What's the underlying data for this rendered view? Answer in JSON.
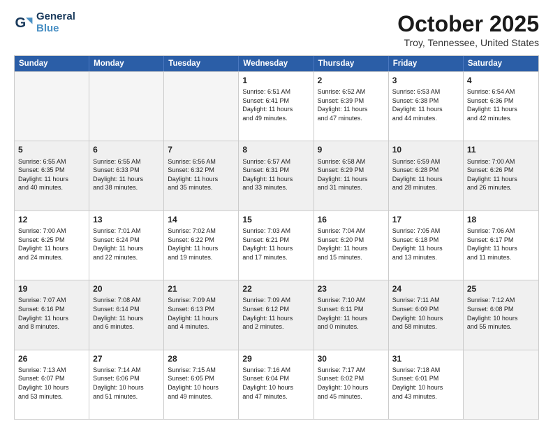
{
  "logo": {
    "line1": "General",
    "line2": "Blue"
  },
  "title": "October 2025",
  "subtitle": "Troy, Tennessee, United States",
  "header_days": [
    "Sunday",
    "Monday",
    "Tuesday",
    "Wednesday",
    "Thursday",
    "Friday",
    "Saturday"
  ],
  "rows": [
    [
      {
        "day": "",
        "text": "",
        "empty": true
      },
      {
        "day": "",
        "text": "",
        "empty": true
      },
      {
        "day": "",
        "text": "",
        "empty": true
      },
      {
        "day": "1",
        "text": "Sunrise: 6:51 AM\nSunset: 6:41 PM\nDaylight: 11 hours\nand 49 minutes."
      },
      {
        "day": "2",
        "text": "Sunrise: 6:52 AM\nSunset: 6:39 PM\nDaylight: 11 hours\nand 47 minutes."
      },
      {
        "day": "3",
        "text": "Sunrise: 6:53 AM\nSunset: 6:38 PM\nDaylight: 11 hours\nand 44 minutes."
      },
      {
        "day": "4",
        "text": "Sunrise: 6:54 AM\nSunset: 6:36 PM\nDaylight: 11 hours\nand 42 minutes."
      }
    ],
    [
      {
        "day": "5",
        "text": "Sunrise: 6:55 AM\nSunset: 6:35 PM\nDaylight: 11 hours\nand 40 minutes.",
        "shaded": true
      },
      {
        "day": "6",
        "text": "Sunrise: 6:55 AM\nSunset: 6:33 PM\nDaylight: 11 hours\nand 38 minutes.",
        "shaded": true
      },
      {
        "day": "7",
        "text": "Sunrise: 6:56 AM\nSunset: 6:32 PM\nDaylight: 11 hours\nand 35 minutes.",
        "shaded": true
      },
      {
        "day": "8",
        "text": "Sunrise: 6:57 AM\nSunset: 6:31 PM\nDaylight: 11 hours\nand 33 minutes.",
        "shaded": true
      },
      {
        "day": "9",
        "text": "Sunrise: 6:58 AM\nSunset: 6:29 PM\nDaylight: 11 hours\nand 31 minutes.",
        "shaded": true
      },
      {
        "day": "10",
        "text": "Sunrise: 6:59 AM\nSunset: 6:28 PM\nDaylight: 11 hours\nand 28 minutes.",
        "shaded": true
      },
      {
        "day": "11",
        "text": "Sunrise: 7:00 AM\nSunset: 6:26 PM\nDaylight: 11 hours\nand 26 minutes.",
        "shaded": true
      }
    ],
    [
      {
        "day": "12",
        "text": "Sunrise: 7:00 AM\nSunset: 6:25 PM\nDaylight: 11 hours\nand 24 minutes."
      },
      {
        "day": "13",
        "text": "Sunrise: 7:01 AM\nSunset: 6:24 PM\nDaylight: 11 hours\nand 22 minutes."
      },
      {
        "day": "14",
        "text": "Sunrise: 7:02 AM\nSunset: 6:22 PM\nDaylight: 11 hours\nand 19 minutes."
      },
      {
        "day": "15",
        "text": "Sunrise: 7:03 AM\nSunset: 6:21 PM\nDaylight: 11 hours\nand 17 minutes."
      },
      {
        "day": "16",
        "text": "Sunrise: 7:04 AM\nSunset: 6:20 PM\nDaylight: 11 hours\nand 15 minutes."
      },
      {
        "day": "17",
        "text": "Sunrise: 7:05 AM\nSunset: 6:18 PM\nDaylight: 11 hours\nand 13 minutes."
      },
      {
        "day": "18",
        "text": "Sunrise: 7:06 AM\nSunset: 6:17 PM\nDaylight: 11 hours\nand 11 minutes."
      }
    ],
    [
      {
        "day": "19",
        "text": "Sunrise: 7:07 AM\nSunset: 6:16 PM\nDaylight: 11 hours\nand 8 minutes.",
        "shaded": true
      },
      {
        "day": "20",
        "text": "Sunrise: 7:08 AM\nSunset: 6:14 PM\nDaylight: 11 hours\nand 6 minutes.",
        "shaded": true
      },
      {
        "day": "21",
        "text": "Sunrise: 7:09 AM\nSunset: 6:13 PM\nDaylight: 11 hours\nand 4 minutes.",
        "shaded": true
      },
      {
        "day": "22",
        "text": "Sunrise: 7:09 AM\nSunset: 6:12 PM\nDaylight: 11 hours\nand 2 minutes.",
        "shaded": true
      },
      {
        "day": "23",
        "text": "Sunrise: 7:10 AM\nSunset: 6:11 PM\nDaylight: 11 hours\nand 0 minutes.",
        "shaded": true
      },
      {
        "day": "24",
        "text": "Sunrise: 7:11 AM\nSunset: 6:09 PM\nDaylight: 10 hours\nand 58 minutes.",
        "shaded": true
      },
      {
        "day": "25",
        "text": "Sunrise: 7:12 AM\nSunset: 6:08 PM\nDaylight: 10 hours\nand 55 minutes.",
        "shaded": true
      }
    ],
    [
      {
        "day": "26",
        "text": "Sunrise: 7:13 AM\nSunset: 6:07 PM\nDaylight: 10 hours\nand 53 minutes."
      },
      {
        "day": "27",
        "text": "Sunrise: 7:14 AM\nSunset: 6:06 PM\nDaylight: 10 hours\nand 51 minutes."
      },
      {
        "day": "28",
        "text": "Sunrise: 7:15 AM\nSunset: 6:05 PM\nDaylight: 10 hours\nand 49 minutes."
      },
      {
        "day": "29",
        "text": "Sunrise: 7:16 AM\nSunset: 6:04 PM\nDaylight: 10 hours\nand 47 minutes."
      },
      {
        "day": "30",
        "text": "Sunrise: 7:17 AM\nSunset: 6:02 PM\nDaylight: 10 hours\nand 45 minutes."
      },
      {
        "day": "31",
        "text": "Sunrise: 7:18 AM\nSunset: 6:01 PM\nDaylight: 10 hours\nand 43 minutes."
      },
      {
        "day": "",
        "text": "",
        "empty": true
      }
    ]
  ]
}
